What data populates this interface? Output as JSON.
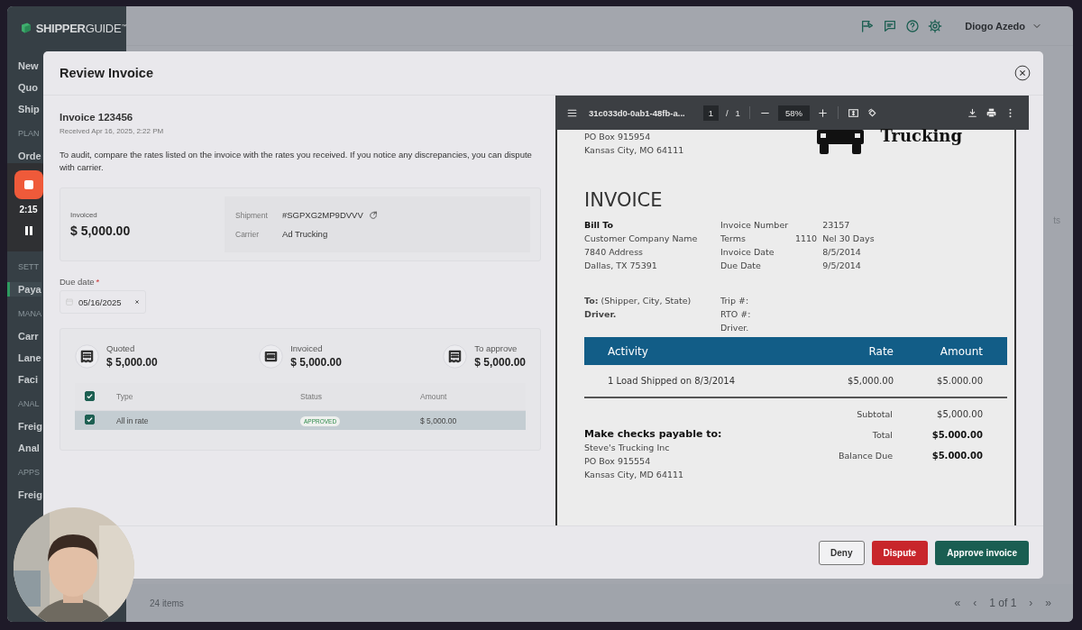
{
  "app": {
    "logo": "**SHIPPER**GUIDE$^{™}$",
    "user": "Diogo Azedo"
  },
  "sidebar": {
    "sections": [
      {
        "items": [
          {
            "label": "New",
            "selected": false
          },
          {
            "label": "Quo",
            "selected": false
          },
          {
            "label": "Ship",
            "selected": false
          }
        ]
      },
      {
        "heading": "PLAN",
        "items": [
          {
            "label": "Orde",
            "selected": false
          }
        ]
      },
      {
        "heading": "SETT",
        "items": [
          {
            "label": "Paya",
            "selected": true
          }
        ]
      },
      {
        "heading": "MANA",
        "items": [
          {
            "label": "Carr",
            "selected": false
          },
          {
            "label": "Lane",
            "selected": false
          },
          {
            "label": "Faci",
            "selected": false
          }
        ]
      },
      {
        "heading": "ANAL",
        "items": [
          {
            "label": "Freig",
            "selected": false
          },
          {
            "label": "Anal",
            "selected": false
          }
        ]
      },
      {
        "heading": "APPS",
        "items": [
          {
            "label": "Freig",
            "selected": false
          }
        ]
      }
    ]
  },
  "recorder": {
    "time": "2:15"
  },
  "background": {
    "partial_text": "ts",
    "item_count": "24 items",
    "pagination": [
      "«",
      "‹",
      "1 of 1",
      "›",
      "»"
    ]
  },
  "modal": {
    "title": "Review Invoice",
    "invoice": {
      "title": "Invoice 123456",
      "received": "Received Apr 16, 2025, 2:22 PM"
    },
    "instructions": "To audit, compare the rates listed on the invoice with the rates you received. If you notice any discrepancies, you can dispute with carrier.",
    "summary": {
      "label": "Invoiced",
      "value": "$ 5,000.00",
      "details": [
        {
          "label": "Shipment",
          "value": "#SGPXG2MP9DVVV",
          "kind": "link"
        },
        {
          "label": "Carrier",
          "value": "Ad Trucking",
          "kind": "text"
        }
      ]
    },
    "due_date": {
      "label": "Due date",
      "required": true,
      "required_mark": "*",
      "value": "05/16/2025"
    },
    "totals": [
      {
        "label": "Quoted",
        "value": "$ 5,000.00",
        "kind": "receipt"
      },
      {
        "label": "Invoiced",
        "value": "$ 5,000.00",
        "kind": "ticket"
      },
      {
        "label": "To approve",
        "value": "$ 5,000.00",
        "kind": "receipt"
      }
    ],
    "table": {
      "columns": [
        "Type",
        "Status",
        "Amount"
      ],
      "all_checked": true,
      "rows": [
        {
          "checked": true,
          "selected": true,
          "type": "All in rate",
          "status": "APPROVED",
          "amount": "$ 5,000.00"
        }
      ]
    },
    "pdf": {
      "file": "31c033d0-0ab1-48fb-a...",
      "page": "1",
      "separator": "/",
      "pages": "1",
      "zoom": "58%",
      "address": [
        "PO Box 915954",
        "Kansas City, MO 64111"
      ],
      "brand": "Trucking",
      "heading": "INVOICE",
      "bill_to": {
        "heading": "Bill To",
        "lines": [
          "Customer Company Name",
          "7840 Address",
          "Dallas, TX 75391"
        ]
      },
      "meta": [
        {
          "label": "Invoice Number",
          "value": "23157"
        },
        {
          "label": "Terms",
          "note": "1110",
          "value": "Nel 30 Days"
        },
        {
          "label": "Invoice Date",
          "value": "8/5/2014"
        },
        {
          "label": "Due Date",
          "value": "9/5/2014"
        }
      ],
      "ship_to": [
        "**To:** (Shipper, City, State)",
        "**Driver.**"
      ],
      "trip": [
        "Trip #:",
        "RTO #:",
        "Driver."
      ],
      "columns": [
        "Activity",
        "Rate",
        "Amount"
      ],
      "lines": [
        {
          "activity": "1 Load Shipped on 8/3/2014",
          "rate": "$5,000.00",
          "amount": "$5.000.00"
        }
      ],
      "totals": [
        {
          "label": "Subtotal",
          "value": "$5,000.00",
          "bold": false
        },
        {
          "label": "Total",
          "value": "$5.000.00",
          "bold": true
        },
        {
          "label": "Balance Due",
          "value": "$5.000.00",
          "bold": true
        }
      ],
      "payable": {
        "heading": "Make checks payable to:",
        "lines": [
          "Steve's Trucking Inc",
          "PO Box 915554",
          "Kansas City, MD 64111"
        ]
      }
    },
    "buttons": [
      {
        "label": "Deny",
        "kind": "outline"
      },
      {
        "label": "Dispute",
        "kind": "danger"
      },
      {
        "label": "Approve invoice",
        "kind": "primary"
      }
    ]
  }
}
